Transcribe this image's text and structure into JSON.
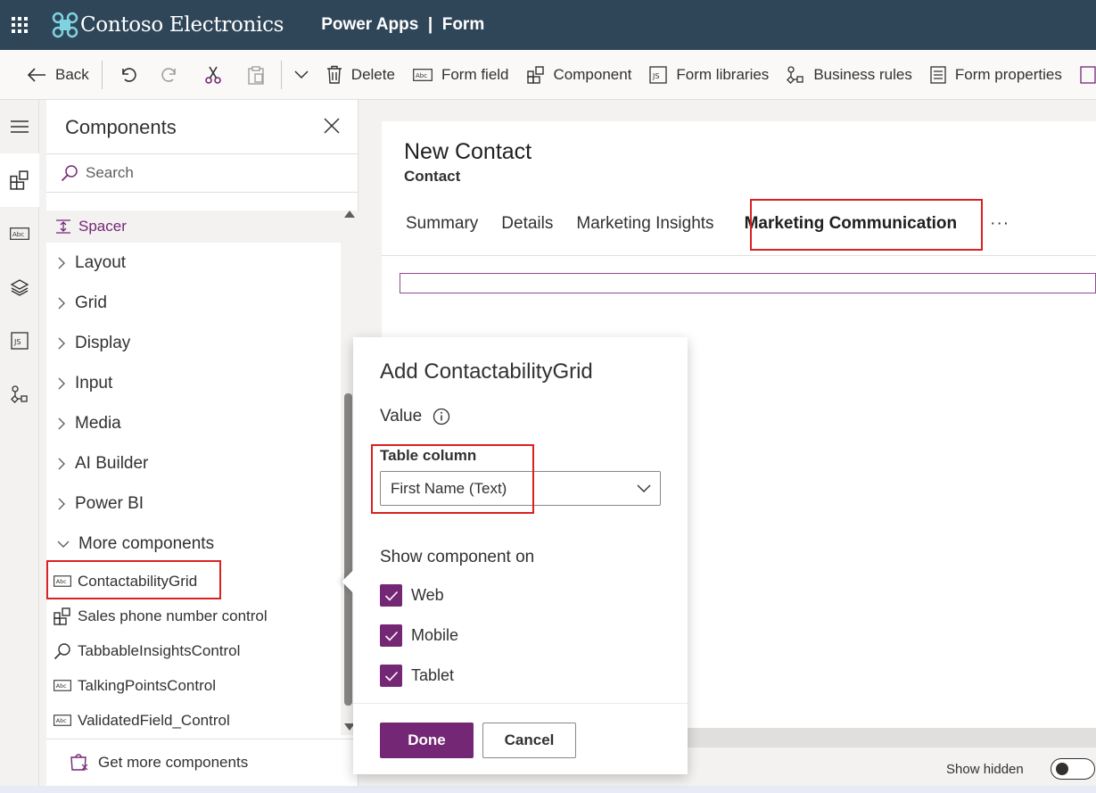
{
  "header": {
    "brand": "Contoso Electronics",
    "app_title": "Power Apps  |  Form"
  },
  "commands": {
    "back": "Back",
    "delete": "Delete",
    "form_field": "Form field",
    "component": "Component",
    "form_libraries": "Form libraries",
    "business_rules": "Business rules",
    "form_properties": "Form properties"
  },
  "panel": {
    "title": "Components",
    "search_placeholder": "Search",
    "spacer": "Spacer",
    "categories": [
      "Layout",
      "Grid",
      "Display",
      "Input",
      "Media",
      "AI Builder",
      "Power BI",
      "More components"
    ],
    "more_components": [
      "ContactabilityGrid",
      "Sales phone number control",
      "TabbableInsightsControl",
      "TalkingPointsControl",
      "ValidatedField_Control"
    ],
    "get_more": "Get more components"
  },
  "form": {
    "title": "New Contact",
    "subtitle": "Contact",
    "tabs": [
      "Summary",
      "Details",
      "Marketing Insights",
      "Marketing Communication"
    ],
    "more_tabs": "···",
    "show_hidden": "Show hidden"
  },
  "callout": {
    "title": "Add ContactabilityGrid",
    "value_label": "Value",
    "table_column_label": "Table column",
    "table_column_value": "First Name (Text)",
    "show_on_label": "Show component on",
    "checkboxes": [
      "Web",
      "Mobile",
      "Tablet"
    ],
    "done": "Done",
    "cancel": "Cancel"
  },
  "colors": {
    "header_bg": "#2f4659",
    "accent": "#742774",
    "highlight_border": "#d92121"
  }
}
